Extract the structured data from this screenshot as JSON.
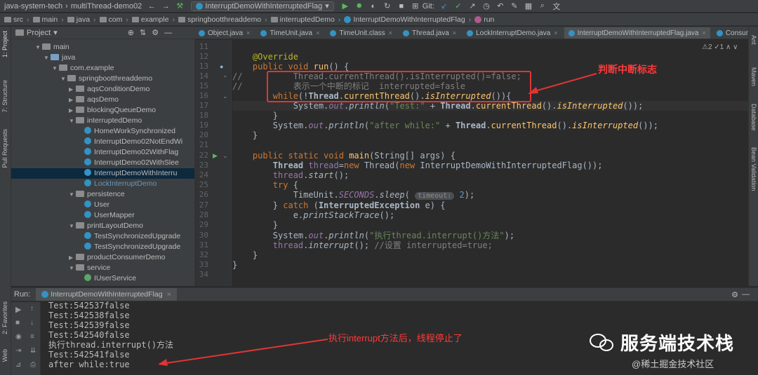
{
  "toolbar": {
    "project_title": "java-system-tech",
    "module": "multiThread-demo02",
    "run_config": "InterruptDemoWithInterruptedFlag",
    "git_label": "Git:"
  },
  "breadcrumb": [
    "src",
    "main",
    "java",
    "com",
    "example",
    "springbootthreaddemo",
    "interruptedDemo",
    "InterruptDemoWithInterruptedFlag",
    "run"
  ],
  "project_panel": {
    "title": "Project",
    "tree": [
      {
        "label": "main",
        "indent": 3,
        "type": "folder",
        "open": true
      },
      {
        "label": "java",
        "indent": 4,
        "type": "folder-blue",
        "open": true
      },
      {
        "label": "com.example",
        "indent": 5,
        "type": "folder",
        "open": true
      },
      {
        "label": "springbootthreaddemo",
        "indent": 6,
        "type": "folder",
        "open": true
      },
      {
        "label": "aqsConditionDemo",
        "indent": 7,
        "type": "folder",
        "open": false
      },
      {
        "label": "aqsDemo",
        "indent": 7,
        "type": "folder",
        "open": false
      },
      {
        "label": "blockingQueueDemo",
        "indent": 7,
        "type": "folder",
        "open": false
      },
      {
        "label": "interruptedDemo",
        "indent": 7,
        "type": "folder",
        "open": true
      },
      {
        "label": "HomeWorkSynchronized",
        "indent": 8,
        "type": "class"
      },
      {
        "label": "InterruptDemo02NotEndWi",
        "indent": 8,
        "type": "class"
      },
      {
        "label": "InterruptDemo02WithFlag",
        "indent": 8,
        "type": "class"
      },
      {
        "label": "InterruptDemo02WithSlee",
        "indent": 8,
        "type": "class"
      },
      {
        "label": "InterruptDemoWithInterru",
        "indent": 8,
        "type": "class",
        "selected": true
      },
      {
        "label": "LockInterruptDemo",
        "indent": 8,
        "type": "class",
        "dim": true
      },
      {
        "label": "persistence",
        "indent": 7,
        "type": "folder",
        "open": true
      },
      {
        "label": "User",
        "indent": 8,
        "type": "class"
      },
      {
        "label": "UserMapper",
        "indent": 8,
        "type": "class"
      },
      {
        "label": "printLayoutDemo",
        "indent": 7,
        "type": "folder",
        "open": true
      },
      {
        "label": "TestSynchronizedUpgrade",
        "indent": 8,
        "type": "class"
      },
      {
        "label": "TestSynchronizedUpgrade",
        "indent": 8,
        "type": "class"
      },
      {
        "label": "productConsumerDemo",
        "indent": 7,
        "type": "folder",
        "open": false
      },
      {
        "label": "service",
        "indent": 7,
        "type": "folder",
        "open": true
      },
      {
        "label": "IUserService",
        "indent": 8,
        "type": "interface"
      }
    ]
  },
  "tabs": [
    {
      "label": "Object.java"
    },
    {
      "label": "TimeUnit.java"
    },
    {
      "label": "TimeUnit.class"
    },
    {
      "label": "Thread.java"
    },
    {
      "label": "LockInterruptDemo.java"
    },
    {
      "label": "InterruptDemoWithInterruptedFlag.java",
      "active": true
    },
    {
      "label": "Consumer.java"
    }
  ],
  "editor": {
    "status": "⚠2 ✓1 ∧ ∨",
    "line_numbers": [
      "11",
      "12",
      "13",
      "14",
      "15",
      "16",
      "17",
      "18",
      "19",
      "20",
      "21",
      "22",
      "23",
      "24",
      "25",
      "26",
      "27",
      "28",
      "29",
      "30",
      "31",
      "32",
      "33",
      "34"
    ],
    "hint_label": "timeout:"
  },
  "annotations": {
    "code_note": "判断中断标志",
    "console_note": "执行interrupt方法后，线程停止了"
  },
  "run_panel": {
    "label": "Run:",
    "tab": "InterruptDemoWithInterruptedFlag",
    "console": [
      "Test:542537false",
      "Test:542538false",
      "Test:542539false",
      "Test:542540false",
      "执行thread.interrupt()方法",
      "Test:542541false",
      "after while:true"
    ]
  },
  "side_tools": {
    "left": [
      "1: Project",
      "7: Structure",
      "Pull Requests",
      "2: Favorites",
      "Web"
    ],
    "right": [
      "Ant",
      "Maven",
      "Database",
      "Bean Validation"
    ]
  },
  "watermark": {
    "title": "服务端技术栈",
    "sub": "@稀土掘金技术社区"
  }
}
